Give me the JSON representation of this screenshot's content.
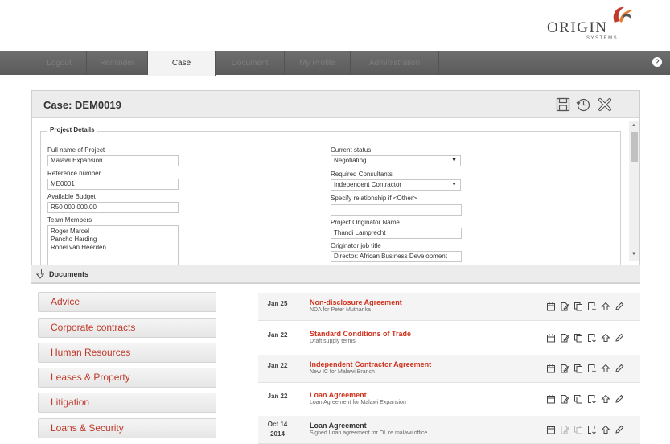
{
  "brand": {
    "name": "ORIGIN",
    "sub": "SYSTEMS"
  },
  "nav": {
    "tabs": [
      {
        "label": "Logout"
      },
      {
        "label": "Reminder"
      },
      {
        "label": "Case"
      },
      {
        "label": "Document"
      },
      {
        "label": "My Profile"
      },
      {
        "label": "Administration"
      }
    ],
    "active": "Case",
    "help": "?"
  },
  "case": {
    "title": "Case: DEM0019",
    "section": "Project Details",
    "left_fields": [
      {
        "label": "Full name of Project",
        "value": "Malawi Expansion"
      },
      {
        "label": "Reference number",
        "value": "ME0001"
      },
      {
        "label": "Available Budget",
        "value": "R50 000 000.00"
      }
    ],
    "team": {
      "label": "Team Members",
      "members": [
        "Roger Marcel",
        "Pancho Harding",
        "Ronel van Heerden"
      ]
    },
    "right_fields": [
      {
        "label": "Current status",
        "value": "Negotiating",
        "type": "select"
      },
      {
        "label": "Required Consultants",
        "value": "Independent Contractor",
        "type": "select"
      },
      {
        "label": "Specify relationship if <Other>",
        "value": "",
        "type": "text"
      },
      {
        "label": "Project Originator Name",
        "value": "Thandi Lamprecht",
        "type": "text"
      },
      {
        "label": "Originator job title",
        "value": "Director: African Business Development",
        "type": "text"
      }
    ]
  },
  "documents": {
    "title": "Documents",
    "categories": [
      "Advice",
      "Corporate contracts",
      "Human Resources",
      "Leases & Property",
      "Litigation",
      "Loans & Security"
    ],
    "items": [
      {
        "date": "Jan 25",
        "title": "Non-disclosure Agreement",
        "sub": "NDA for Peter Mutharika"
      },
      {
        "date": "Jan 22",
        "title": "Standard Conditions of Trade",
        "sub": "Draft supply terms"
      },
      {
        "date": "Jan 22",
        "title": "Independent Contractor Agreement",
        "sub": "New IC for Malawi Branch"
      },
      {
        "date": "Jan 22",
        "title": "Loan Agreement",
        "sub": "Loan Agreement for Malawi Expansion"
      },
      {
        "date": "Oct 14\n2014",
        "title": "Loan Agreement",
        "sub": "Signed Loan agreement for OL re malawi office"
      }
    ]
  },
  "colors": {
    "accent": "#d0321d",
    "nav_bg": "#606060"
  }
}
